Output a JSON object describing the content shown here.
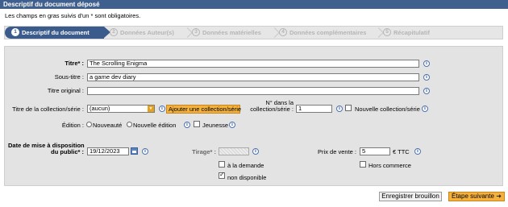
{
  "header": {
    "title": "Descriptif du document déposé"
  },
  "notice": {
    "mandatory": "Les champs en gras suivis d'un * sont obligatoires."
  },
  "steps": [
    {
      "num": "1",
      "label": "Descriptif du document"
    },
    {
      "num": "2",
      "label": "Données Auteur(s)"
    },
    {
      "num": "3",
      "label": "Données matérielles"
    },
    {
      "num": "4",
      "label": "Données complémentaires"
    },
    {
      "num": "5",
      "label": "Récapitulatif"
    }
  ],
  "form": {
    "titre_label": "Titre* :",
    "titre_value": "The Scrolling Enigma",
    "soustitre_label": "Sous-titre :",
    "soustitre_value": "a game dev diary",
    "titre_original_label": "Titre original :",
    "titre_original_value": "",
    "collection_label": "Titre de la collection/série :",
    "collection_value": "(aucun)",
    "add_collection_label": "Ajouter une collection/série",
    "num_collection_label_1": "N° dans la",
    "num_collection_label_2": "collection/série :",
    "num_collection_value": "1",
    "nouvelle_collection_label": "Nouvelle collection/série",
    "edition_label": "Édition :",
    "edition_option_1": "Nouveauté",
    "edition_option_2": "Nouvelle édition",
    "jeunesse_label": "Jeunesse",
    "date_label_1": "Date de mise à disposition",
    "date_label_2": "du public* :",
    "date_value": "19/12/2023",
    "tirage_label": "Tirage* :",
    "prix_label": "Prix de vente :",
    "prix_value": "5",
    "prix_unit": "€ TTC",
    "a_la_demande_label": "à la demande",
    "hors_commerce_label": "Hors commerce",
    "non_disponible_label": "non disponible",
    "info_glyph": "i"
  },
  "actions": {
    "save_label": "Enregistrer brouillon",
    "next_label": "Étape suivante",
    "next_arrow": "➜"
  },
  "colors": {
    "header_bg": "#3f5f8f",
    "active_step": "#3a5b8c",
    "accent_orange": "#f5b13d"
  }
}
